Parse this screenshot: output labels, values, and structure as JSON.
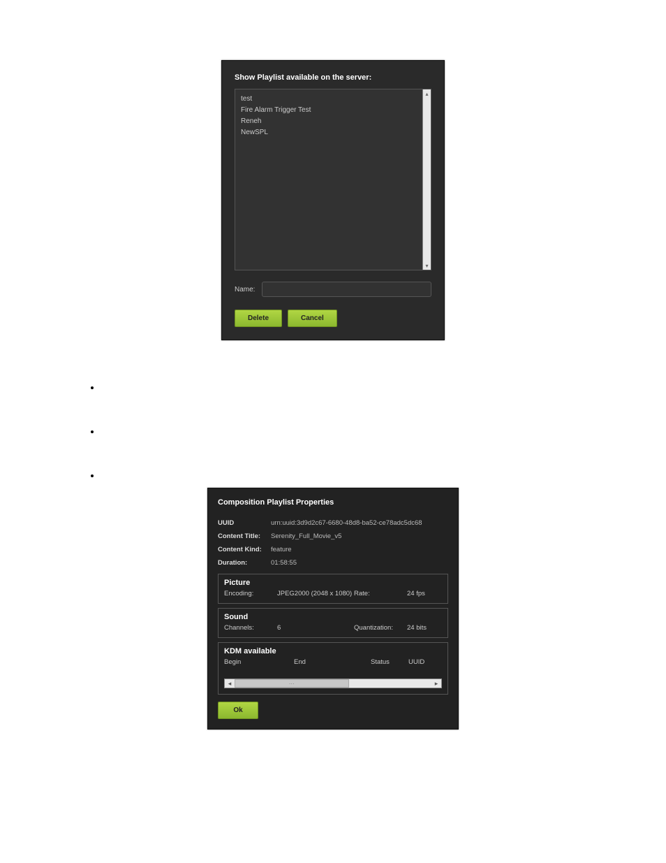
{
  "dialog1": {
    "title": "Show Playlist available on the server:",
    "items": [
      "test",
      "Fire Alarm Trigger Test",
      "Reneh",
      "NewSPL"
    ],
    "name_label": "Name:",
    "name_value": "",
    "delete_label": "Delete",
    "cancel_label": "Cancel"
  },
  "bullets": [
    "",
    "",
    ""
  ],
  "dialog2": {
    "title": "Composition Playlist Properties",
    "uuid_label": "UUID",
    "uuid_value": "urn:uuid:3d9d2c67-6680-48d8-ba52-ce78adc5dc68",
    "content_title_label": "Content Title:",
    "content_title_value": "Serenity_Full_Movie_v5",
    "content_kind_label": "Content Kind:",
    "content_kind_value": "feature",
    "duration_label": "Duration:",
    "duration_value": "01:58:55",
    "picture": {
      "heading": "Picture",
      "encoding_label": "Encoding:",
      "encoding_value": "JPEG2000 (2048 x 1080)",
      "rate_label": "Rate:",
      "rate_value": "24 fps"
    },
    "sound": {
      "heading": "Sound",
      "channels_label": "Channels:",
      "channels_value": "6",
      "quant_label": "Quantization:",
      "quant_value": "24 bits"
    },
    "kdm": {
      "heading": "KDM available",
      "col_begin": "Begin",
      "col_end": "End",
      "col_status": "Status",
      "col_uuid": "UUID"
    },
    "ok_label": "Ok"
  }
}
